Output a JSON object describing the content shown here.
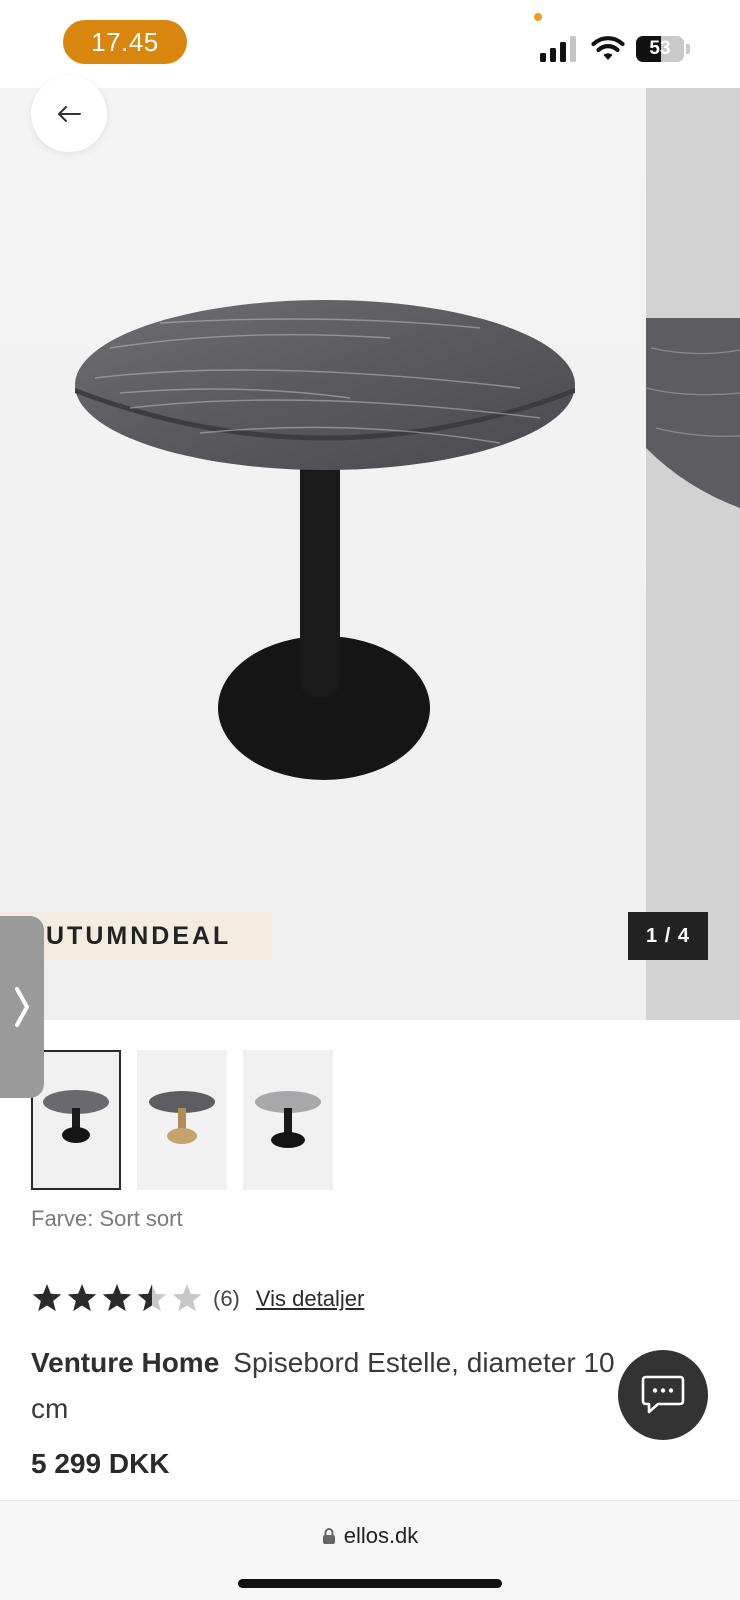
{
  "status_bar": {
    "time": "17.45",
    "battery_level": "53",
    "battery_fraction": 0.53
  },
  "gallery": {
    "promo_tag": "UTUMNDEAL",
    "pager": "1 / 4"
  },
  "product": {
    "color_label": "Farve: Sort sort",
    "rating": 3.5,
    "rating_max": 5,
    "review_count": "(6)",
    "details_link": "Vis detaljer",
    "brand": "Venture Home",
    "name": "Spisebord Estelle, diameter 10",
    "name_cont": "cm",
    "price": "5 299 DKK"
  },
  "browser": {
    "url": "ellos.dk"
  },
  "icons": {
    "back": "arrow-left-icon",
    "chat": "chat-bubble-icon",
    "side_tab": "chevron-right-icon",
    "lock": "lock-icon"
  },
  "colors": {
    "time_pill": "#d9860f",
    "promo_bg": "#f3ece0",
    "pager_bg": "#222222",
    "chat_bg": "#333333"
  }
}
